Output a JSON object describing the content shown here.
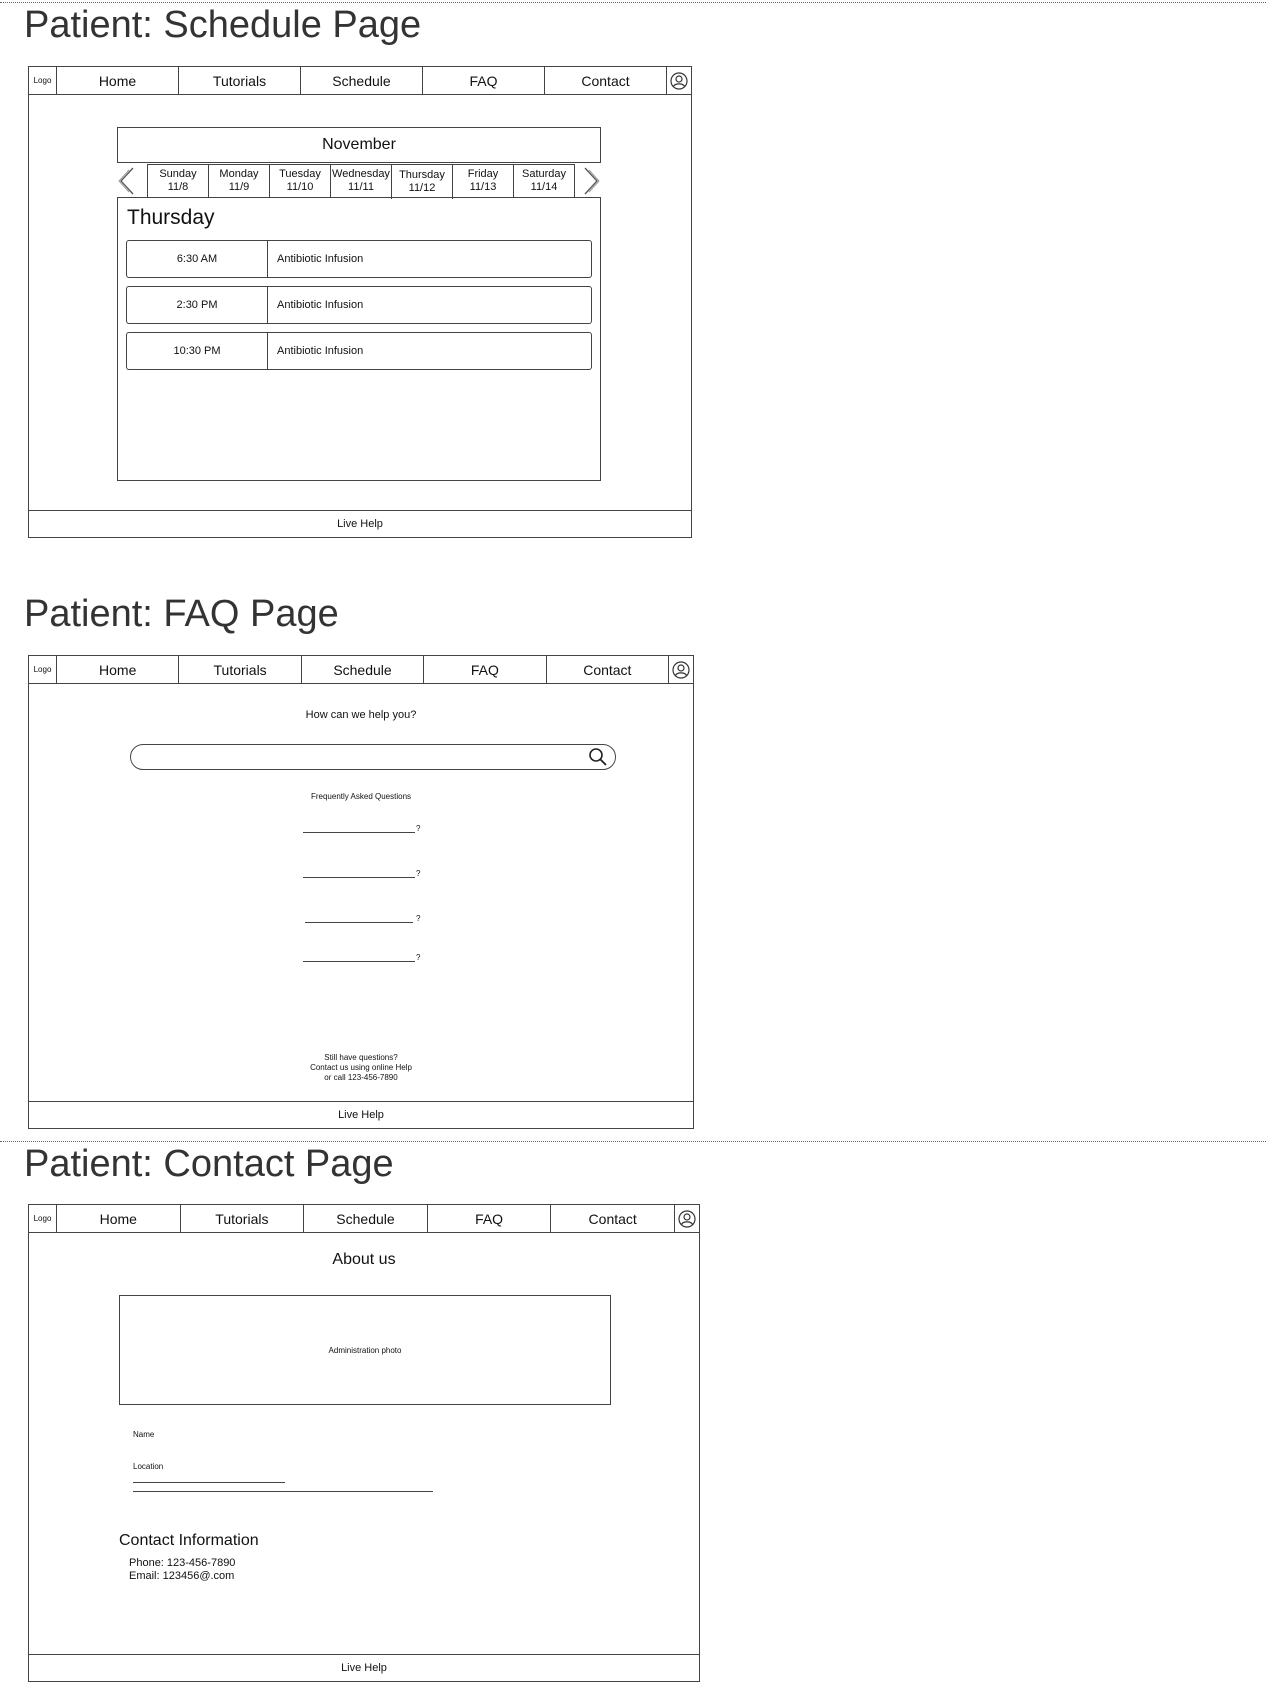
{
  "nav": {
    "logo": "Logo",
    "items": [
      "Home",
      "Tutorials",
      "Schedule",
      "FAQ",
      "Contact"
    ]
  },
  "footer": {
    "live_help": "Live Help"
  },
  "schedule": {
    "title": "Patient: Schedule Page",
    "month": "November",
    "days": [
      {
        "name": "Sunday",
        "date": "11/8"
      },
      {
        "name": "Monday",
        "date": "11/9"
      },
      {
        "name": "Tuesday",
        "date": "11/10"
      },
      {
        "name": "Wednesday",
        "date": "11/11"
      },
      {
        "name": "Thursday",
        "date": "11/12"
      },
      {
        "name": "Friday",
        "date": "11/13"
      },
      {
        "name": "Saturday",
        "date": "11/14"
      }
    ],
    "selected_day": "Thursday",
    "appointments": [
      {
        "time": "6:30 AM",
        "desc": "Antibiotic Infusion"
      },
      {
        "time": "2:30 PM",
        "desc": "Antibiotic Infusion"
      },
      {
        "time": "10:30 PM",
        "desc": "Antibiotic Infusion"
      }
    ]
  },
  "faq": {
    "title": "Patient: FAQ Page",
    "prompt": "How can we help you?",
    "search_placeholder": "",
    "heading": "Frequently Asked Questions",
    "question_mark": "?",
    "still_1": "Still have questions?",
    "still_2": "Contact us using online Help",
    "still_3": "or call 123-456-7890"
  },
  "contact": {
    "title": "Patient: Contact Page",
    "about": "About us",
    "photo": "Administration photo",
    "name_label": "Name",
    "location_label": "Location",
    "info_heading": "Contact Information",
    "phone": "Phone: 123-456-7890",
    "email": "Email: 123456@.com"
  }
}
